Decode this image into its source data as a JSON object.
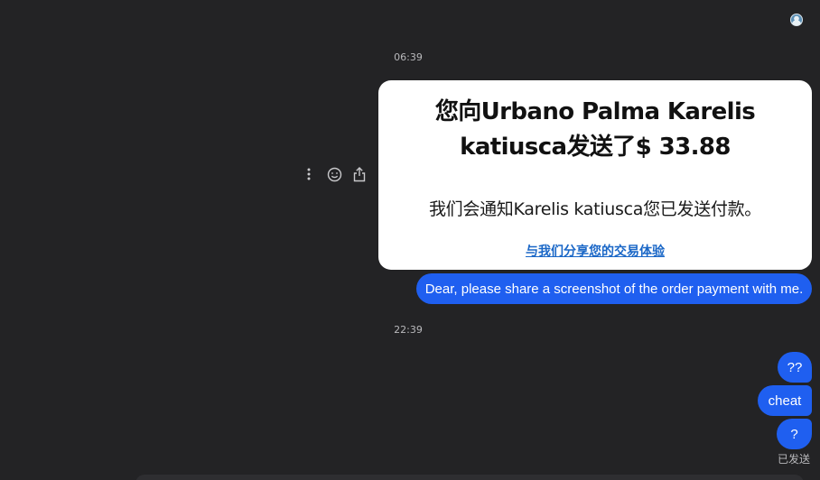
{
  "thread": {
    "timestamps": [
      "06:39",
      "22:39"
    ],
    "status": "已发送"
  },
  "payment_card": {
    "title": "您向Urbano Palma Karelis katiusca发送了$ 33.88",
    "body": "我们会通知Karelis katiusca您已发送付款。",
    "link": "与我们分享您的交易体验"
  },
  "message_actions": [
    "more-vertical-icon",
    "emoji-icon",
    "share-icon"
  ],
  "messages": [
    "Dear, please share a screenshot of the order payment with me.",
    "??",
    "cheat",
    "?"
  ],
  "colors": {
    "background": "#232325",
    "bubble": "#1f5ff0",
    "card": "#ffffff",
    "link": "#1a67c7",
    "timestamp": "#b8b8bb"
  }
}
